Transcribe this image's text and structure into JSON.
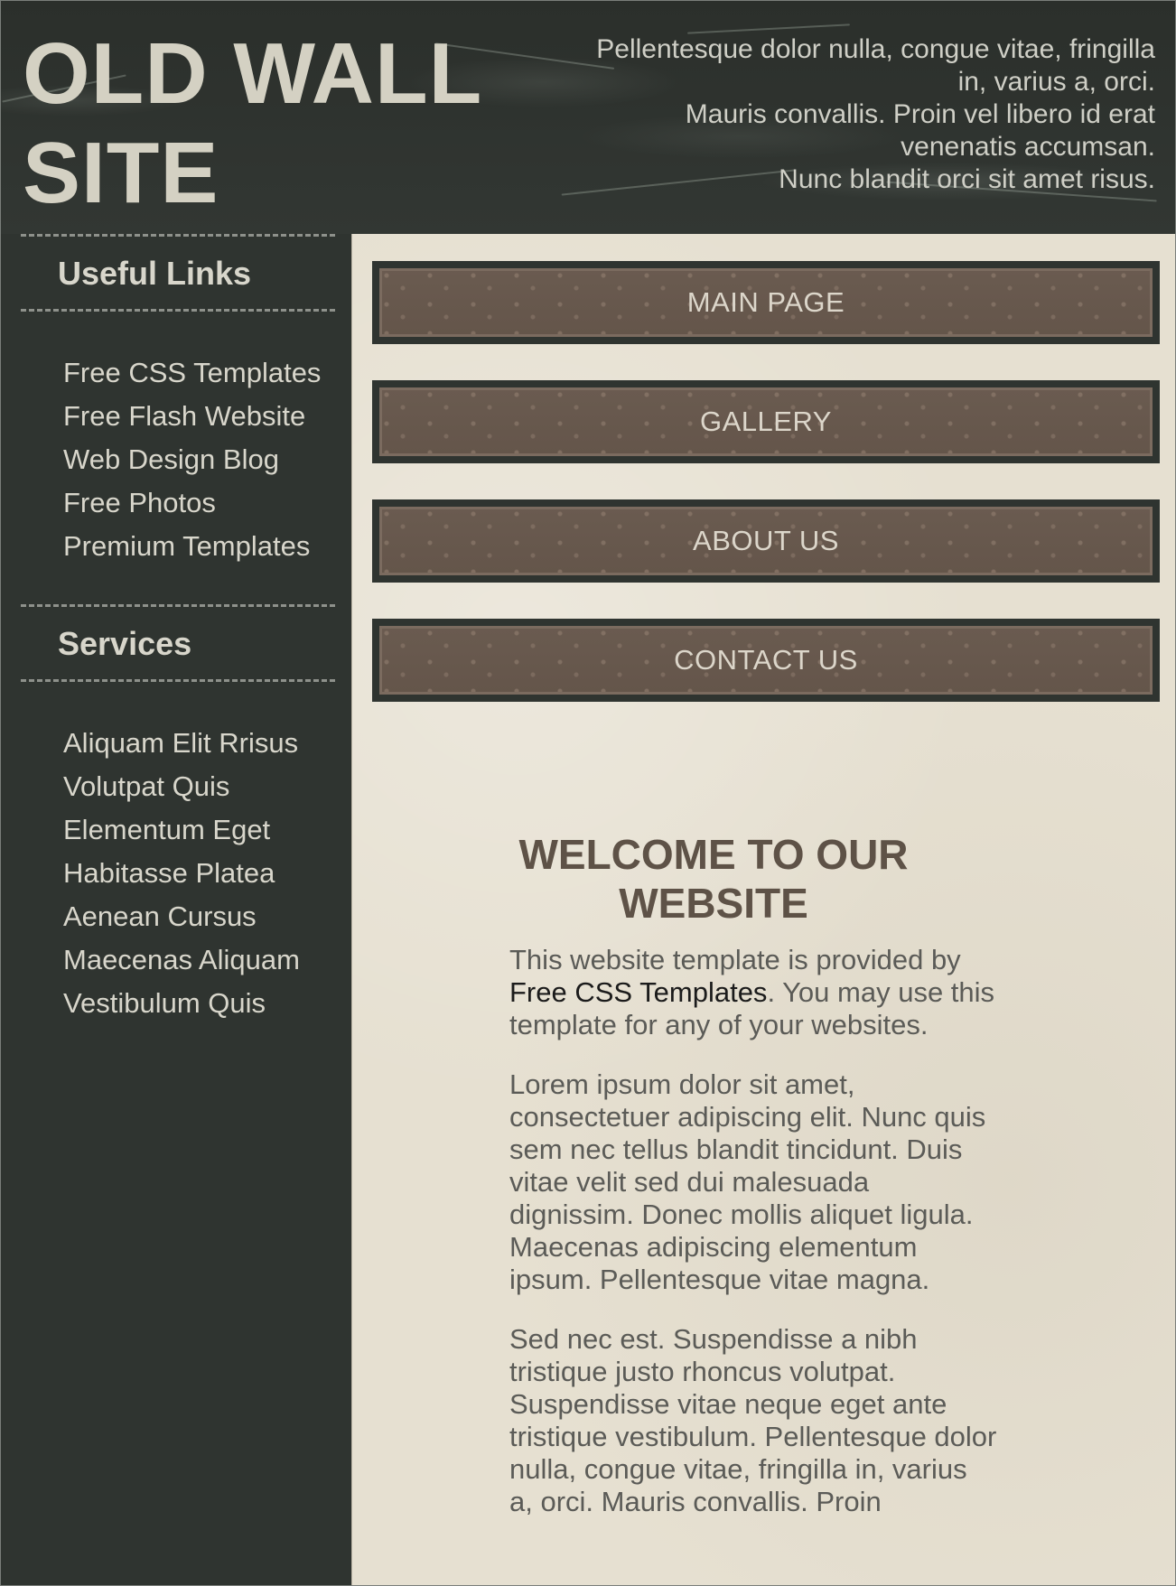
{
  "header": {
    "title": "OLD WALL SITE",
    "tagline_lines": [
      "Pellentesque dolor nulla, congue vitae, fringilla",
      "in, varius a, orci.",
      "Mauris convallis. Proin vel libero id erat",
      "venenatis accumsan.",
      "Nunc blandit orci sit amet risus."
    ]
  },
  "sidebar": {
    "useful_links": {
      "heading": "Useful Links",
      "items": [
        "Free CSS Templates",
        "Free Flash Website",
        "Web Design Blog",
        "Free Photos",
        "Premium Templates"
      ]
    },
    "services": {
      "heading": "Services",
      "items": [
        "Aliquam Elit Rrisus",
        "Volutpat Quis",
        "Elementum Eget",
        "Habitasse Platea",
        "Aenean Cursus",
        "Maecenas Aliquam",
        "Vestibulum Quis"
      ]
    }
  },
  "nav": {
    "items": [
      "MAIN PAGE",
      "GALLERY",
      "ABOUT US",
      "CONTACT US"
    ]
  },
  "main": {
    "welcome_title": "WELCOME TO OUR WEBSITE",
    "intro_before_link": "This website template is provided by ",
    "intro_link": "Free CSS Templates",
    "intro_after_link": ". You may use this template for any of your websites.",
    "paragraph_2": "Lorem ipsum dolor sit amet, consectetuer adipiscing elit. Nunc quis sem nec tellus blandit tincidunt. Duis vitae velit sed dui malesuada dignissim. Donec mollis aliquet ligula. Maecenas adipiscing elementum ipsum. Pellentesque vitae magna.",
    "paragraph_3": "Sed nec est. Suspendisse a nibh tristique justo rhoncus volutpat. Suspendisse vitae neque eget ante tristique vestibulum. Pellentesque dolor nulla, congue vitae, fringilla in, varius a, orci. Mauris convallis. Proin"
  },
  "colors": {
    "dark_background": "#2f3430",
    "title_text": "#d4d1c3",
    "nav_button": "#64554a",
    "content_background": "#e6e0d1",
    "heading_brown": "#5e5247"
  }
}
